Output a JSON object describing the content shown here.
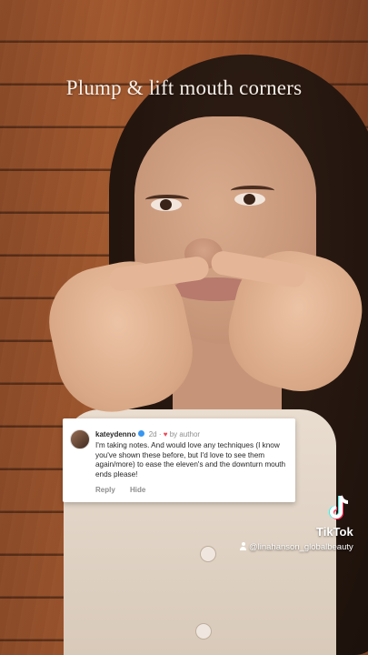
{
  "video": {
    "headline": "Plump & lift mouth corners"
  },
  "comment": {
    "username": "kateydenno",
    "time": "2d",
    "by_author": "by author",
    "text": "I'm taking notes. And would love any techniques (I know you've shown these before, but I'd love to see them again/more)  to ease the eleven's and the downturn mouth ends please!",
    "reply_label": "Reply",
    "hide_label": "Hide"
  },
  "watermark": {
    "brand": "TikTok",
    "handle": "@linahanson_globalbeauty"
  },
  "colors": {
    "verified": "#3897f0",
    "heart": "#ed4956",
    "wood": "#9b532c"
  }
}
